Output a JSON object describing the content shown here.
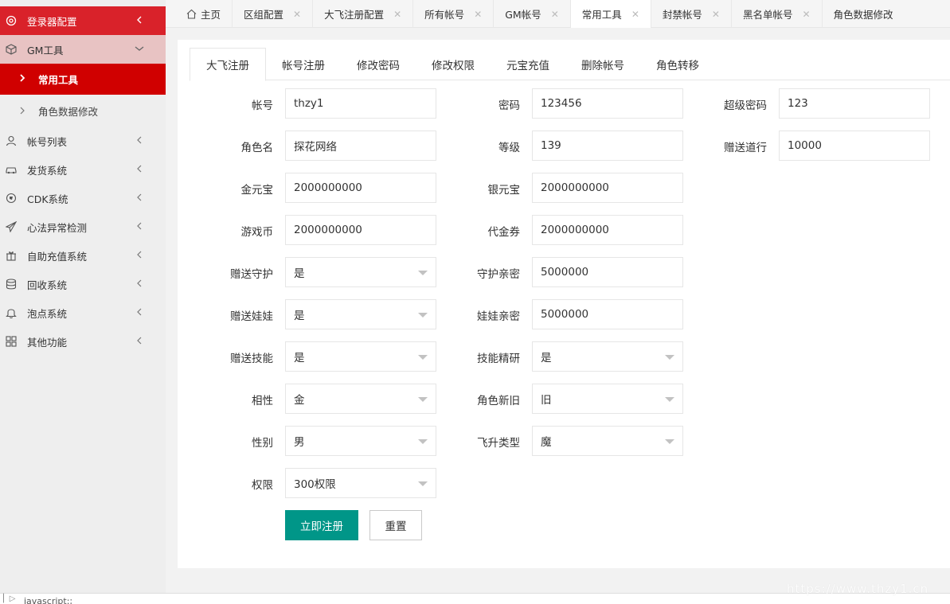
{
  "sidebar": {
    "top": "登录器配置",
    "gm": "GM工具",
    "common": "常用工具",
    "sub": "角色数据修改",
    "items": [
      {
        "label": "帐号列表",
        "icon": "user-icon"
      },
      {
        "label": "发货系统",
        "icon": "car-icon"
      },
      {
        "label": "CDK系统",
        "icon": "globe-icon"
      },
      {
        "label": "心法异常检测",
        "icon": "paper-plane-icon"
      },
      {
        "label": "自助充值系统",
        "icon": "gift-icon"
      },
      {
        "label": "回收系统",
        "icon": "database-icon"
      },
      {
        "label": "泡点系统",
        "icon": "bell-icon"
      },
      {
        "label": "其他功能",
        "icon": "grid-icon"
      }
    ]
  },
  "tabs": [
    "主页",
    "区组配置",
    "大飞注册配置",
    "所有帐号",
    "GM帐号",
    "常用工具",
    "封禁帐号",
    "黑名单帐号",
    "角色数据修改"
  ],
  "subtabs": [
    "大飞注册",
    "帐号注册",
    "修改密码",
    "修改权限",
    "元宝充值",
    "删除帐号",
    "角色转移"
  ],
  "form": {
    "account": {
      "label": "帐号",
      "value": "thzy1"
    },
    "password": {
      "label": "密码",
      "value": "123456"
    },
    "superpwd": {
      "label": "超级密码",
      "value": "123"
    },
    "rolename": {
      "label": "角色名",
      "value": "探花网络"
    },
    "level": {
      "label": "等级",
      "value": "139"
    },
    "daoxing": {
      "label": "赠送道行",
      "value": "10000"
    },
    "gold": {
      "label": "金元宝",
      "value": "2000000000"
    },
    "silver": {
      "label": "银元宝",
      "value": "2000000000"
    },
    "coin": {
      "label": "游戏币",
      "value": "2000000000"
    },
    "voucher": {
      "label": "代金券",
      "value": "2000000000"
    },
    "guard": {
      "label": "赠送守护",
      "value": "是"
    },
    "guardint": {
      "label": "守护亲密",
      "value": "5000000"
    },
    "doll": {
      "label": "赠送娃娃",
      "value": "是"
    },
    "dollint": {
      "label": "娃娃亲密",
      "value": "5000000"
    },
    "skill": {
      "label": "赠送技能",
      "value": "是"
    },
    "skillres": {
      "label": "技能精研",
      "value": "是"
    },
    "element": {
      "label": "相性",
      "value": "金"
    },
    "oldnew": {
      "label": "角色新旧",
      "value": "旧"
    },
    "gender": {
      "label": "性别",
      "value": "男"
    },
    "ascend": {
      "label": "飞升类型",
      "value": "魔"
    },
    "perm": {
      "label": "权限",
      "value": "300权限"
    }
  },
  "buttons": {
    "submit": "立即注册",
    "reset": "重置"
  },
  "bottom": "javascript:;",
  "watermark": "https://www.thzy1.cn"
}
